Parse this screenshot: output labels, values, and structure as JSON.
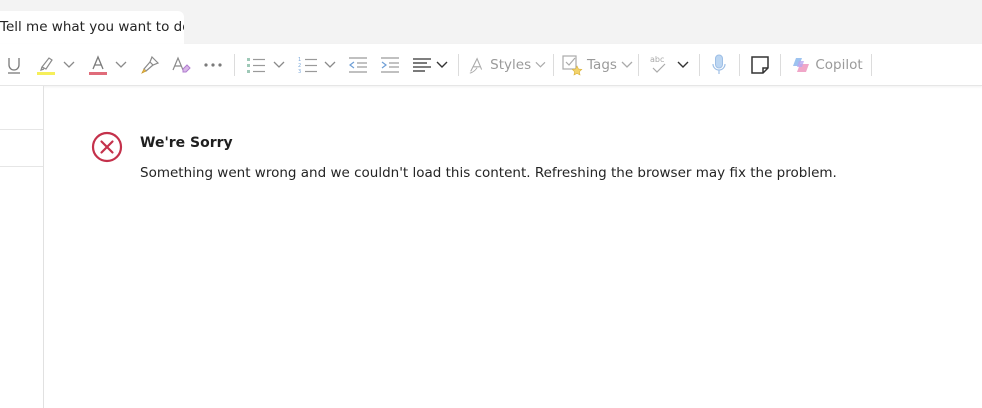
{
  "search": {
    "placeholder": "Tell me what you want to do"
  },
  "toolbar": {
    "styles_label": "Styles",
    "tags_label": "Tags",
    "spell_label": "abc",
    "copilot_label": "Copilot"
  },
  "error": {
    "title": "We're Sorry",
    "message": "Something went wrong and we couldn't load this content. Refreshing the browser may fix the problem."
  },
  "colors": {
    "error_red": "#c4314b",
    "highlight_yellow": "#f6ef5a",
    "font_red": "#e06c7a",
    "icon_gray": "#8a8a8a",
    "disabled_gray": "#b5b5b5"
  }
}
